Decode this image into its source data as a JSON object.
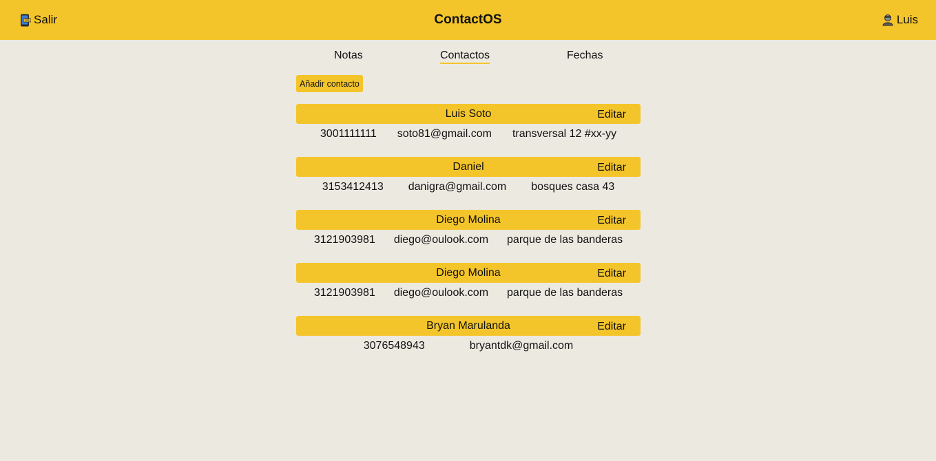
{
  "header": {
    "logout_label": "Salir",
    "app_title": "ContactOS",
    "user_name": "Luis"
  },
  "nav": {
    "tabs": [
      {
        "label": "Notas"
      },
      {
        "label": "Contactos",
        "active": true
      },
      {
        "label": "Fechas"
      }
    ]
  },
  "actions": {
    "add_contact_label": "Añadir contacto"
  },
  "contacts": [
    {
      "name": "Luis Soto",
      "phone": "3001111111",
      "email": "soto81@gmail.com",
      "address": "transversal 12 #xx-yy",
      "edit_label": "Editar"
    },
    {
      "name": "Daniel",
      "phone": "3153412413",
      "email": "danigra@gmail.com",
      "address": "bosques casa 43",
      "edit_label": "Editar"
    },
    {
      "name": "Diego Molina",
      "phone": "3121903981",
      "email": "diego@oulook.com",
      "address": "parque de las banderas",
      "edit_label": "Editar"
    },
    {
      "name": "Diego Molina",
      "phone": "3121903981",
      "email": "diego@oulook.com",
      "address": "parque de las banderas",
      "edit_label": "Editar"
    },
    {
      "name": "Bryan Marulanda",
      "phone": "3076548943",
      "email": "bryantdk@gmail.com",
      "address": "",
      "edit_label": "Editar"
    }
  ],
  "colors": {
    "accent": "#f4c52b",
    "background": "#ece9e1"
  },
  "icons": {
    "logout": "phone-off-icon",
    "user": "user-avatar-icon"
  }
}
